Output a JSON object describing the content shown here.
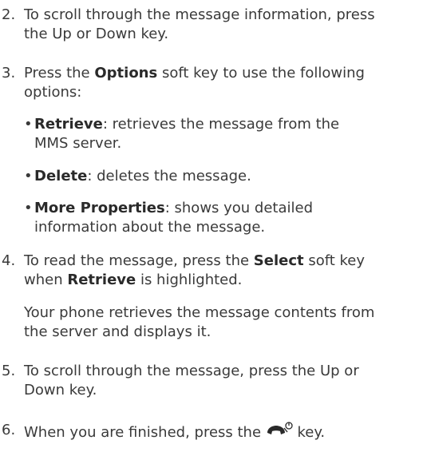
{
  "step2": {
    "num": "2.",
    "line1": "To scroll through the message information, press",
    "line2": "the Up or Down key."
  },
  "step3": {
    "num": "3.",
    "pre": "Press the ",
    "bold": "Options",
    "post": " soft key to use the following",
    "line2": "options:"
  },
  "bullets": [
    {
      "dot": "•",
      "term": "Retrieve",
      "desc1": ": retrieves the message from the",
      "desc2": "MMS server."
    },
    {
      "dot": "•",
      "term": "Delete",
      "desc1": ": deletes the message."
    },
    {
      "dot": "•",
      "term": "More Properties",
      "desc1": ": shows you detailed",
      "desc2": "information about the message."
    }
  ],
  "step4": {
    "num": "4.",
    "pre": "To read the message, press the ",
    "bold": "Select",
    "post": " soft key",
    "line2_pre": "when ",
    "line2_bold": "Retrieve",
    "line2_post": " is highlighted."
  },
  "step4_para": {
    "line1": "Your phone retrieves the message contents from",
    "line2": "the server and displays it."
  },
  "step5": {
    "num": "5.",
    "line1": "To scroll through the message, press the Up or",
    "line2": "Down key."
  },
  "step6": {
    "num": "6.",
    "pre": "When you are finished, press the ",
    "post": " key.",
    "icon": "end-power-key-icon"
  }
}
